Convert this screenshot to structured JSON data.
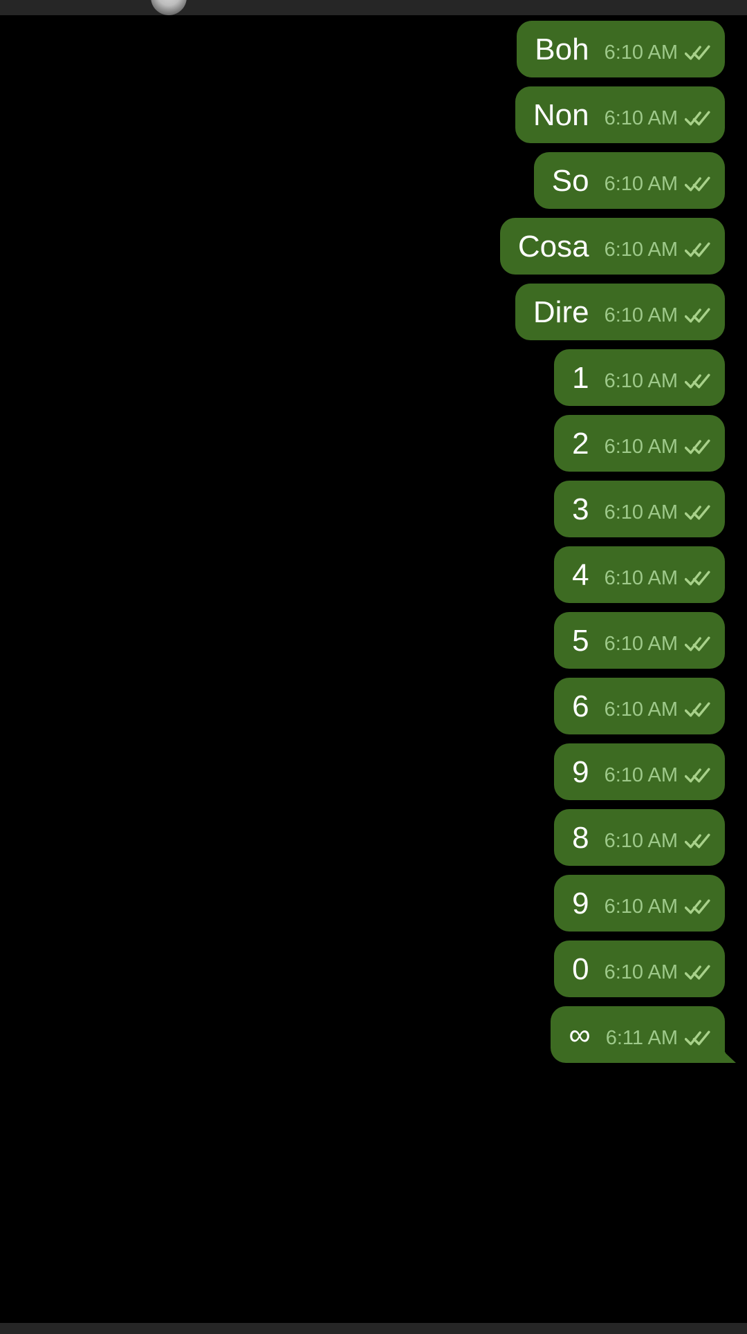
{
  "app": {
    "background_color": "#000000",
    "bar_color": "#262626",
    "bubble_color": "#3d6b22",
    "bubble_text_color": "#ffffff",
    "timestamp_color": "#9ec98a",
    "tick_color": "#a8d18a"
  },
  "top_bar": {
    "avatar_icon": "contact-avatar-icon"
  },
  "bottom_bar": {
    "label": ""
  },
  "chat": {
    "status_icon": "double-check-icon",
    "messages": [
      {
        "text": "Boh",
        "time": "6:10 AM",
        "status": "read",
        "tail": false
      },
      {
        "text": "Non",
        "time": "6:10 AM",
        "status": "read",
        "tail": false
      },
      {
        "text": "So",
        "time": "6:10 AM",
        "status": "read",
        "tail": false
      },
      {
        "text": "Cosa",
        "time": "6:10 AM",
        "status": "read",
        "tail": false
      },
      {
        "text": "Dire",
        "time": "6:10 AM",
        "status": "read",
        "tail": false
      },
      {
        "text": "1",
        "time": "6:10 AM",
        "status": "read",
        "tail": false
      },
      {
        "text": "2",
        "time": "6:10 AM",
        "status": "read",
        "tail": false
      },
      {
        "text": "3",
        "time": "6:10 AM",
        "status": "read",
        "tail": false
      },
      {
        "text": "4",
        "time": "6:10 AM",
        "status": "read",
        "tail": false
      },
      {
        "text": "5",
        "time": "6:10 AM",
        "status": "read",
        "tail": false
      },
      {
        "text": "6",
        "time": "6:10 AM",
        "status": "read",
        "tail": false
      },
      {
        "text": "9",
        "time": "6:10 AM",
        "status": "read",
        "tail": false
      },
      {
        "text": "8",
        "time": "6:10 AM",
        "status": "read",
        "tail": false
      },
      {
        "text": "9",
        "time": "6:10 AM",
        "status": "read",
        "tail": false
      },
      {
        "text": "0",
        "time": "6:10 AM",
        "status": "read",
        "tail": false
      },
      {
        "text": "∞",
        "time": "6:11 AM",
        "status": "read",
        "tail": true
      }
    ]
  }
}
